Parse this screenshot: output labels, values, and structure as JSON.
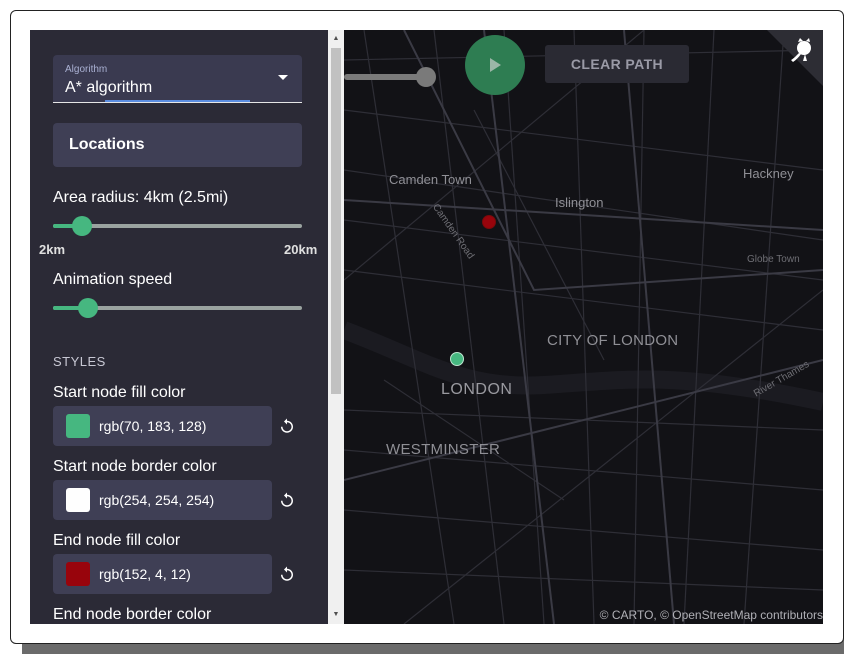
{
  "sidebar": {
    "algorithm_label": "Algorithm",
    "algorithm_value": "A* algorithm",
    "locations_label": "Locations",
    "area_radius_label": "Area radius: 4km (2.5mi)",
    "area_radius": {
      "min_label": "2km",
      "max_label": "20km",
      "value_fraction": 0.115
    },
    "animation_speed_label": "Animation speed",
    "animation_speed": {
      "value_fraction": 0.14
    },
    "styles_heading": "STYLES",
    "colors": [
      {
        "label": "Start node fill color",
        "value": "rgb(70, 183, 128)",
        "swatch": "#46b780"
      },
      {
        "label": "Start node border color",
        "value": "rgb(254, 254, 254)",
        "swatch": "#fefefe"
      },
      {
        "label": "End node fill color",
        "value": "rgb(152, 4, 12)",
        "swatch": "#98040c"
      },
      {
        "label": "End node border color"
      }
    ]
  },
  "map": {
    "clear_path_label": "CLEAR PATH",
    "places": {
      "camden": "Camden Town",
      "islington": "Islington",
      "hackney": "Hackney",
      "globe": "Globe Town",
      "city": "CITY OF LONDON",
      "london": "LONDON",
      "westminster": "WESTMINSTER",
      "camden_road": "Camden Road",
      "river": "River Thames"
    },
    "attribution": "© CARTO, © OpenStreetMap contributors",
    "start_node_color": "#46b780",
    "end_node_color": "#98040c",
    "accent": "#46b780"
  }
}
